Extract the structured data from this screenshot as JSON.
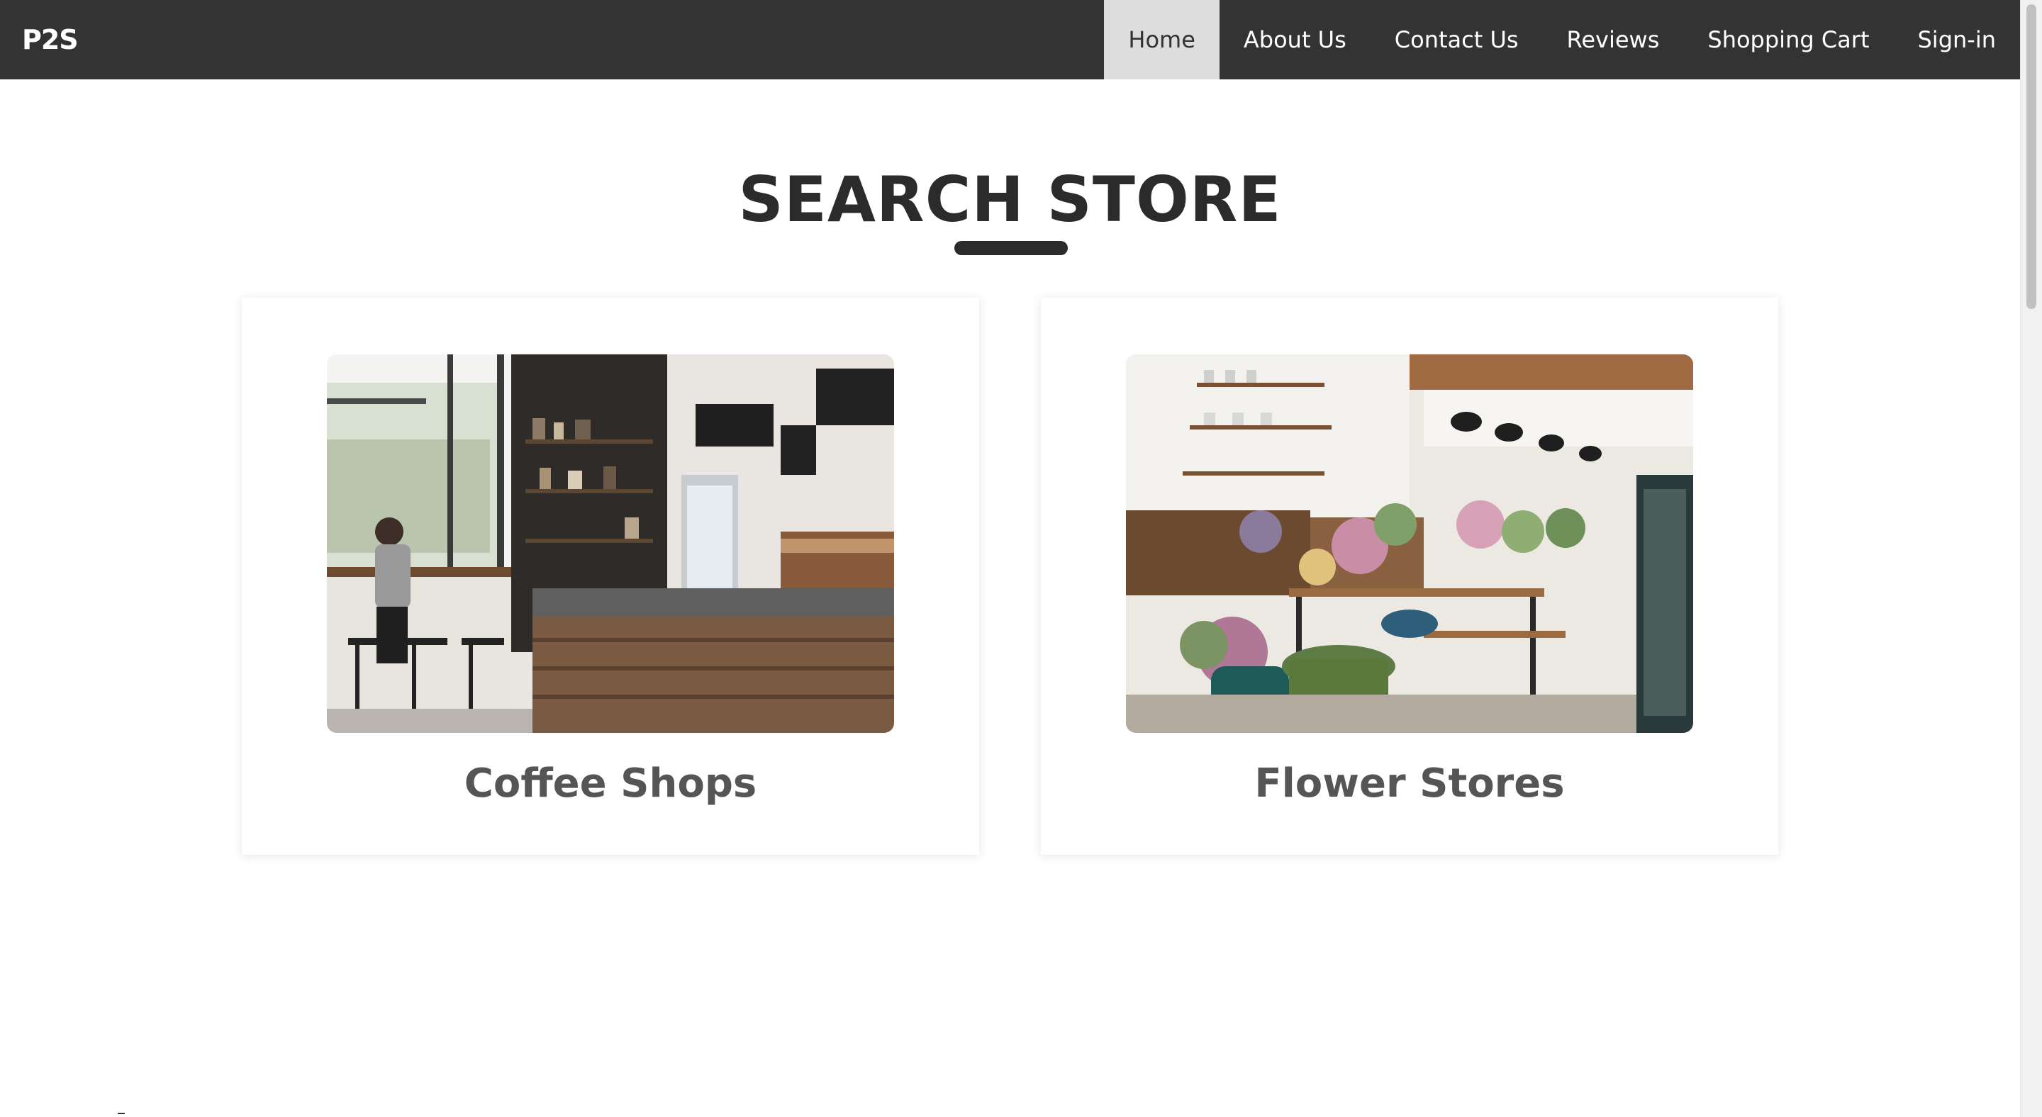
{
  "brand": "P2S",
  "nav": {
    "items": [
      {
        "label": "Home",
        "active": true
      },
      {
        "label": "About Us",
        "active": false
      },
      {
        "label": "Contact Us",
        "active": false
      },
      {
        "label": "Reviews",
        "active": false
      },
      {
        "label": "Shopping Cart",
        "active": false
      },
      {
        "label": "Sign-in",
        "active": false
      }
    ]
  },
  "main": {
    "heading": "SEARCH STORE",
    "cards": [
      {
        "title": "Coffee Shops",
        "image": "coffee-shop-interior-photo"
      },
      {
        "title": "Flower Stores",
        "image": "flower-store-interior-photo"
      }
    ]
  },
  "colors": {
    "navbar": "#333333",
    "active_nav": "#dddddd",
    "heading": "#2b2b2b",
    "card_title": "#555555"
  }
}
